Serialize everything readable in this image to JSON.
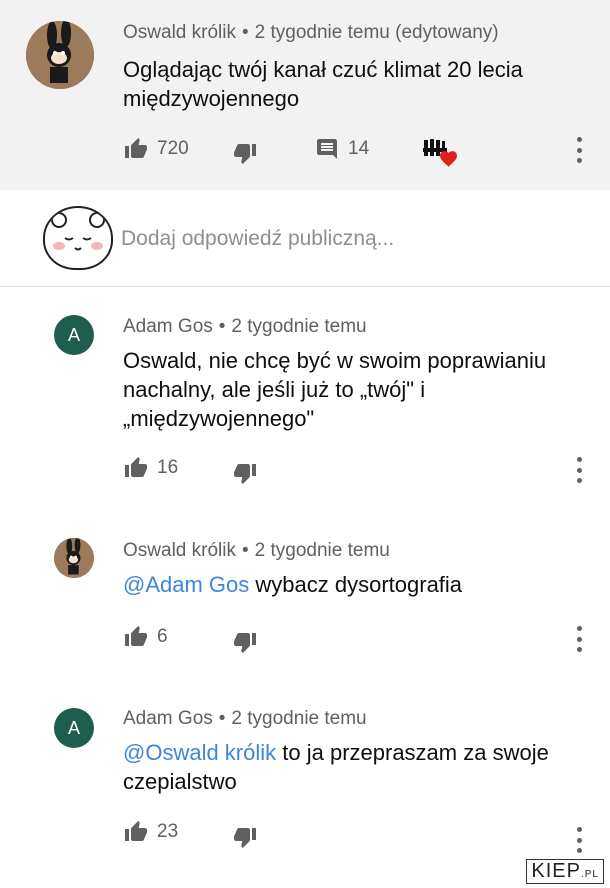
{
  "comment": {
    "author": "Oswald królik",
    "time": "2 tygodnie temu (edytowany)",
    "text": "Oglądając twój kanał czuć klimat 20 lecia międzywojennego",
    "likes": "720",
    "replies": "14"
  },
  "reply_box": {
    "placeholder": "Dodaj odpowiedź publiczną..."
  },
  "replies": [
    {
      "author": "Adam Gos",
      "initial": "A",
      "time": "2 tygodnie temu",
      "mention": "",
      "text": "Oswald, nie chcę być w swoim poprawianiu nachalny, ale jeśli już to „twój\" i „międzywojennego\"",
      "likes": "16"
    },
    {
      "author": "Oswald królik",
      "time": "2 tygodnie temu",
      "mention": "@Adam Gos",
      "text": "wybacz dysortografia",
      "likes": "6"
    },
    {
      "author": "Adam Gos",
      "initial": "A",
      "time": "2 tygodnie temu",
      "mention": "@Oswald królik",
      "text": "to ja przepraszam za swoje czepialstwo",
      "likes": "23"
    }
  ],
  "meta_separator": "•",
  "watermark": {
    "brand": "KIEP",
    "suffix": ".PL"
  },
  "colors": {
    "mention": "#3e87d8",
    "avatar_letter_bg": "#1e5e4e",
    "heart": "#e02020",
    "top_bg": "#f2f2f2"
  },
  "icons": [
    "thumb-up-icon",
    "thumb-down-icon",
    "comment-icon",
    "creator-heart-icon",
    "more-vert-icon"
  ]
}
